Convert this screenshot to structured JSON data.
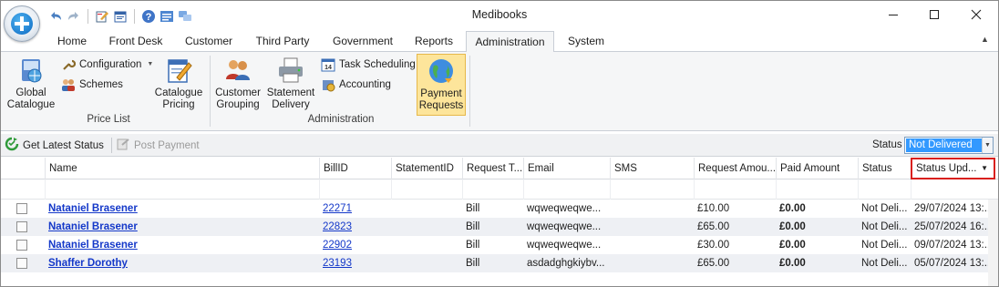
{
  "window": {
    "title": "Medibooks"
  },
  "quick_access": [
    "undo-icon",
    "redo-icon",
    "edit-icon",
    "folder-icon",
    "help-icon",
    "list-icon",
    "chat-icon"
  ],
  "tabs": [
    {
      "label": "Home"
    },
    {
      "label": "Front Desk"
    },
    {
      "label": "Customer"
    },
    {
      "label": "Third Party"
    },
    {
      "label": "Government"
    },
    {
      "label": "Reports"
    },
    {
      "label": "Administration",
      "active": true
    },
    {
      "label": "System"
    }
  ],
  "ribbon": {
    "price_list": {
      "label": "Price List",
      "global_catalogue": "Global\nCatalogue",
      "configuration": "Configuration",
      "schemes": "Schemes",
      "catalogue_pricing": "Catalogue\nPricing"
    },
    "administration": {
      "label": "Administration",
      "customer_grouping": "Customer\nGrouping",
      "statement_delivery": "Statement\nDelivery",
      "task_scheduling": "Task Scheduling",
      "accounting": "Accounting",
      "payment_requests": "Payment\nRequests"
    }
  },
  "toolbar": {
    "get_latest_status": "Get Latest Status",
    "post_payment": "Post Payment",
    "status_label": "Status",
    "status_value": "Not Delivered"
  },
  "grid": {
    "columns": [
      "Name",
      "BillID",
      "StatementID",
      "Request T...",
      "Email",
      "SMS",
      "Request Amou...",
      "Paid Amount",
      "Status",
      "Status Upd..."
    ],
    "rows": [
      {
        "name": "Nataniel Brasener",
        "bill_id": "22271",
        "statement_id": "",
        "request_type": "Bill",
        "email": "wqweqweqwe...",
        "sms": "",
        "request_amount": "£10.00",
        "paid_amount": "£0.00",
        "status": "Not Deli...",
        "status_updated": "29/07/2024  13:..."
      },
      {
        "name": "Nataniel Brasener",
        "bill_id": "22823",
        "statement_id": "",
        "request_type": "Bill",
        "email": "wqweqweqwe...",
        "sms": "",
        "request_amount": "£65.00",
        "paid_amount": "£0.00",
        "status": "Not Deli...",
        "status_updated": "25/07/2024  16:..."
      },
      {
        "name": "Nataniel Brasener",
        "bill_id": "22902",
        "statement_id": "",
        "request_type": "Bill",
        "email": "wqweqweqwe...",
        "sms": "",
        "request_amount": "£30.00",
        "paid_amount": "£0.00",
        "status": "Not Deli...",
        "status_updated": "09/07/2024  13:..."
      },
      {
        "name": "Shaffer Dorothy",
        "bill_id": "23193",
        "statement_id": "",
        "request_type": "Bill",
        "email": "asdadghgkiybv...",
        "sms": "",
        "request_amount": "£65.00",
        "paid_amount": "£0.00",
        "status": "Not Deli...",
        "status_updated": "05/07/2024  13:..."
      }
    ]
  },
  "colors": {
    "accent": "#3399ff",
    "link": "#1438c9",
    "highlight_border": "#d9201d",
    "pressed": "#fde59b"
  }
}
